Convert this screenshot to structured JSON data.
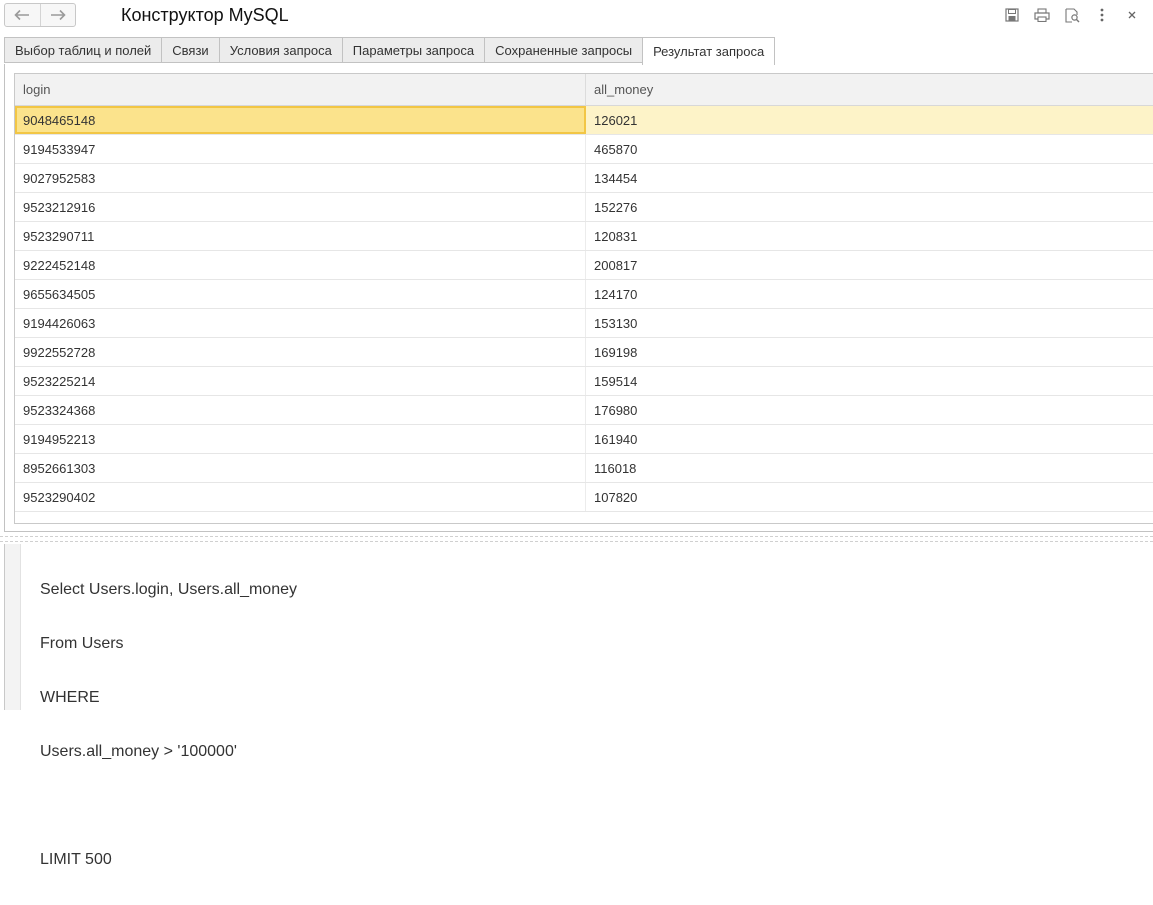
{
  "window": {
    "title": "Конструктор MySQL",
    "nav_icons": [
      "arrow-left-icon",
      "arrow-right-icon"
    ],
    "tool_icons": [
      "save-icon",
      "print-icon",
      "preview-icon",
      "more-icon",
      "close-icon"
    ]
  },
  "tabs": [
    {
      "label": "Выбор таблиц и полей",
      "active": false
    },
    {
      "label": "Связи",
      "active": false
    },
    {
      "label": "Условия запроса",
      "active": false
    },
    {
      "label": "Параметры запроса",
      "active": false
    },
    {
      "label": "Сохраненные запросы",
      "active": false
    },
    {
      "label": "Результат запроса",
      "active": true
    }
  ],
  "grid": {
    "columns": [
      "login",
      "all_money"
    ],
    "rows": [
      [
        "9048465148",
        "126021"
      ],
      [
        "9194533947",
        "465870"
      ],
      [
        "9027952583",
        "134454"
      ],
      [
        "9523212916",
        "152276"
      ],
      [
        "9523290711",
        "120831"
      ],
      [
        "9222452148",
        "200817"
      ],
      [
        "9655634505",
        "124170"
      ],
      [
        "9194426063",
        "153130"
      ],
      [
        "9922552728",
        "169198"
      ],
      [
        "9523225214",
        "159514"
      ],
      [
        "9523324368",
        "176980"
      ],
      [
        "9194952213",
        "161940"
      ],
      [
        "8952661303",
        "116018"
      ],
      [
        "9523290402",
        "107820"
      ]
    ],
    "selected_row": 0
  },
  "editor": {
    "lines": [
      "Select Users.login, Users.all_money",
      "From Users",
      "WHERE",
      "Users.all_money > '100000'",
      "",
      "LIMIT 500"
    ]
  },
  "colors": {
    "selection": "#fbe38c",
    "selection_row": "#fdf3c8",
    "selection_border": "#f2c645"
  }
}
